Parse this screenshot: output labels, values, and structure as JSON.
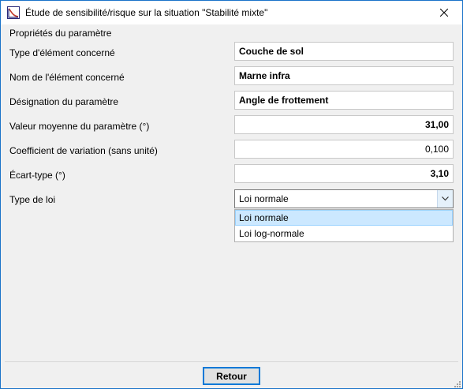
{
  "window": {
    "title": "Étude de sensibilité/risque sur la situation \"Stabilité mixte\"",
    "app_icon": "graph-app-icon",
    "close_icon": "close-icon"
  },
  "section": {
    "title": "Propriétés du paramètre"
  },
  "fields": [
    {
      "label": "Type d'élément concerné",
      "value": "Couche de sol"
    },
    {
      "label": "Nom de l'élément concerné",
      "value": "Marne infra"
    },
    {
      "label": "Désignation du paramètre",
      "value": "Angle de frottement"
    },
    {
      "label": "Valeur moyenne du paramètre (°)",
      "value": "31,00"
    },
    {
      "label": "Coefficient de variation (sans unité)",
      "value": "0,100"
    },
    {
      "label": "Écart-type (°)",
      "value": "3,10"
    }
  ],
  "law": {
    "label": "Type de loi",
    "selected": "Loi normale",
    "options": [
      "Loi normale",
      "Loi log-normale"
    ]
  },
  "footer": {
    "retour_label": "Retour"
  },
  "colors": {
    "accent": "#0078d7",
    "selection": "#cce8ff",
    "window_border": "#1a73c9"
  }
}
